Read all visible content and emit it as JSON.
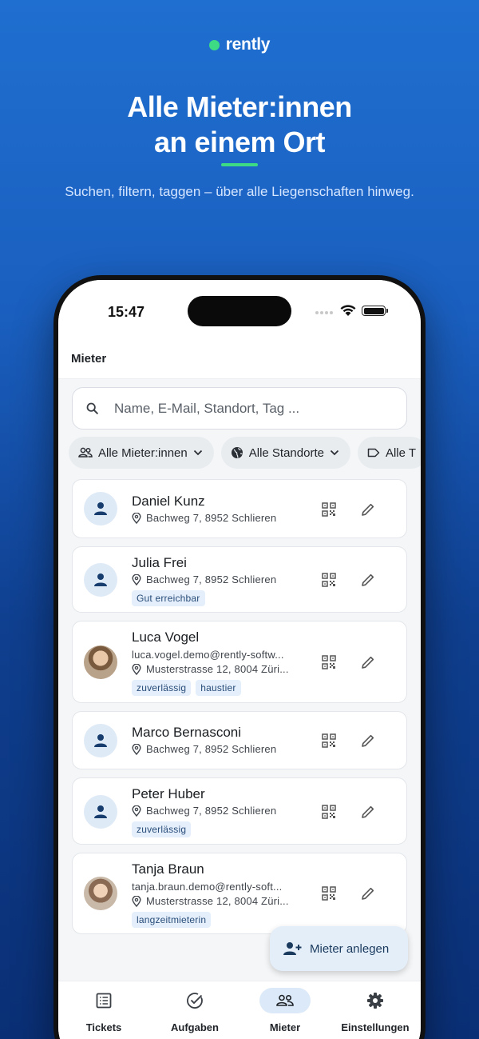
{
  "brand": {
    "name": "rently",
    "accent": "#3ddc84"
  },
  "hero": {
    "title_line1": "Alle Mieter:innen",
    "title_line2": "an einem Ort",
    "subtitle": "Suchen, filtern, taggen – über alle Liegenschaften hinweg."
  },
  "status_bar": {
    "time": "15:47"
  },
  "app_bar": {
    "title": "Mieter"
  },
  "search": {
    "placeholder": "Name, E-Mail, Standort, Tag ..."
  },
  "filters": [
    {
      "label": "Alle Mieter:innen",
      "icon": "people-icon"
    },
    {
      "label": "Alle Standorte",
      "icon": "globe-icon"
    },
    {
      "label": "Alle T",
      "icon": "label-icon"
    }
  ],
  "tenants": [
    {
      "name": "Daniel Kunz",
      "address": "Bachweg 7, 8952 Schlieren",
      "email": "",
      "tags": [],
      "avatar": "person-icon"
    },
    {
      "name": "Julia Frei",
      "address": "Bachweg 7, 8952 Schlieren",
      "email": "",
      "tags": [
        "Gut erreichbar"
      ],
      "avatar": "person-icon"
    },
    {
      "name": "Luca Vogel",
      "email": "luca.vogel.demo@rently-softw...",
      "address": "Musterstrasse 12, 8004 Züri...",
      "tags": [
        "zuverlässig",
        "haustier"
      ],
      "avatar": "photo"
    },
    {
      "name": "Marco Bernasconi",
      "address": "Bachweg 7, 8952 Schlieren",
      "email": "",
      "tags": [],
      "avatar": "person-icon"
    },
    {
      "name": "Peter Huber",
      "address": "Bachweg 7, 8952 Schlieren",
      "email": "",
      "tags": [
        "zuverlässig"
      ],
      "avatar": "person-icon"
    },
    {
      "name": "Tanja Braun",
      "email": "tanja.braun.demo@rently-soft...",
      "address": "Musterstrasse 12, 8004 Züri...",
      "tags": [
        "langzeitmieterin"
      ],
      "avatar": "photo"
    }
  ],
  "fab": {
    "label": "Mieter anlegen"
  },
  "tabs": [
    {
      "label": "Tickets",
      "icon": "list-icon",
      "active": false
    },
    {
      "label": "Aufgaben",
      "icon": "check-circle-icon",
      "active": false
    },
    {
      "label": "Mieter",
      "icon": "people-icon",
      "active": true
    },
    {
      "label": "Einstellungen",
      "icon": "gear-icon",
      "active": false
    }
  ]
}
